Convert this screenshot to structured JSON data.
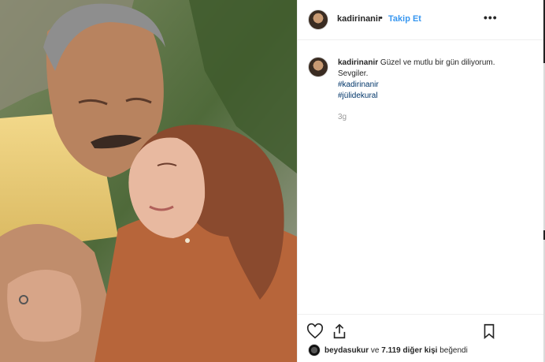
{
  "post": {
    "author": "kadirinanir",
    "separator": "•",
    "follow_label": "Takip Et",
    "more_label": "•••",
    "caption": {
      "username": "kadirinanir",
      "text": "Güzel ve mutlu bir gün diliyorum. Sevgiler.",
      "hashtags": [
        "#kadirinanir",
        "#jülidekural"
      ]
    },
    "time_ago": "3g",
    "likes": {
      "first_user": "beydasukur",
      "connector": "ve",
      "others": "7.119 diğer kişi",
      "suffix": "beğendi"
    }
  },
  "icons": {
    "like": "heart-icon",
    "share": "share-icon",
    "save": "bookmark-icon",
    "more": "more-options-icon"
  },
  "colors": {
    "follow": "#3897f0",
    "hashtag": "#003569",
    "muted": "#999999"
  }
}
